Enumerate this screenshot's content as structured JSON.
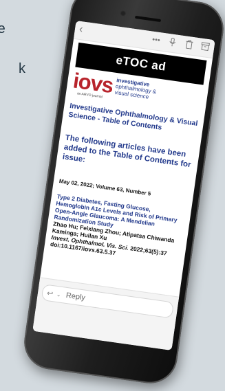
{
  "background": {
    "fragment_1": "re",
    "fragment_2": "k"
  },
  "toolbar": {
    "back_icon": "chevron-left",
    "more_icon": "more-dots",
    "mic_icon": "microphone",
    "trash_icon": "trash",
    "archive_icon": "archive"
  },
  "email": {
    "banner": "eTOC ad",
    "logo": {
      "wordmark": "iovs",
      "line1": "investigative",
      "line2": "ophthalmology &",
      "line3": "visual science",
      "tagline": "an ARVO journal"
    },
    "journal_title": "Investigative Ophthalmology & Visual Science - Table of Contents",
    "notice": "The following articles have been added to the Table of Contents for issue:",
    "issue": "May 02, 2022; Volume 63, Number 5",
    "article": {
      "title": "Type 2 Diabetes, Fasting Glucose, Hemoglobin A1c Levels and Risk of Primary Open-Angle Glaucoma: A Mendelian Randomization Study",
      "authors": "Zhao Hu; Feixiang Zhou; Atipatsa Chiwanda Kaminga; Huilan Xu",
      "journal_abbrev": "Invest. Ophthalmol. Vis. Sci.",
      "citation": "2022;63(5):37 doi:10.1167/iovs.63.5.37"
    }
  },
  "reply": {
    "label": "Reply",
    "icon": "reply-arrow",
    "chevron": "chevron-down"
  },
  "colors": {
    "brand_red": "#b8242c",
    "brand_blue": "#233a8c",
    "banner_bg": "#000000"
  }
}
